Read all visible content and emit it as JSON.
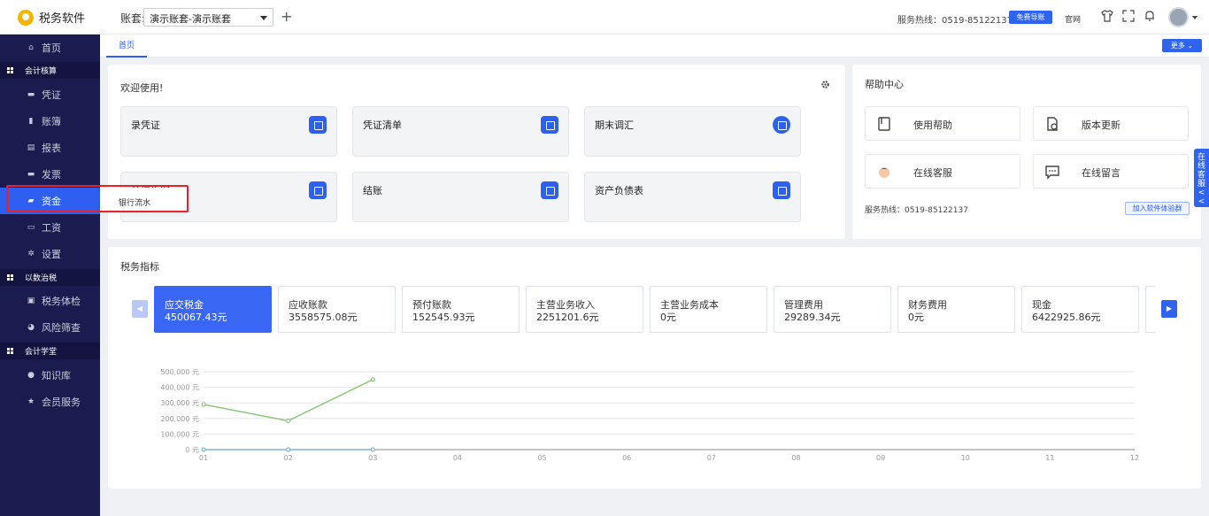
{
  "app": {
    "name": "税务软件"
  },
  "topbar": {
    "account_label": "账套:",
    "account_value": "演示账套-演示账套",
    "hotline": "服务热线：0519-85122137",
    "free_button": "免费导账",
    "official": "官网",
    "icons": [
      "shirt-icon",
      "fullscreen-icon",
      "bell-icon"
    ]
  },
  "sidebar": {
    "items": [
      {
        "label": "首页",
        "icon": "home-icon"
      },
      {
        "label": "会计核算",
        "group": true
      },
      {
        "label": "凭证",
        "icon": "voucher-icon"
      },
      {
        "label": "账簿",
        "icon": "ledger-icon"
      },
      {
        "label": "报表",
        "icon": "report-icon"
      },
      {
        "label": "发票",
        "icon": "invoice-icon"
      },
      {
        "label": "资金",
        "icon": "wallet-icon",
        "active": true
      },
      {
        "label": "工资",
        "icon": "salary-icon"
      },
      {
        "label": "设置",
        "icon": "gear-icon"
      },
      {
        "label": "以数治税",
        "group": true
      },
      {
        "label": "税务体检",
        "icon": "checkup-icon"
      },
      {
        "label": "风险筛查",
        "icon": "risk-icon"
      },
      {
        "label": "会计学堂",
        "group": true
      },
      {
        "label": "知识库",
        "icon": "knowledge-icon"
      },
      {
        "label": "会员服务",
        "icon": "star-icon"
      }
    ],
    "submenu": {
      "label": "银行流水"
    }
  },
  "tabs": {
    "home": "首页",
    "more": "更多 ⌄"
  },
  "welcome": {
    "title": "欢迎使用!",
    "tiles": [
      {
        "label": "录凭证"
      },
      {
        "label": "凭证清单"
      },
      {
        "label": "期末调汇"
      },
      {
        "label": "计提折旧"
      },
      {
        "label": "结账"
      },
      {
        "label": "资产负债表"
      }
    ]
  },
  "help": {
    "title": "帮助中心",
    "tiles": [
      {
        "label": "使用帮助",
        "icon": "book-icon"
      },
      {
        "label": "版本更新",
        "icon": "update-icon"
      },
      {
        "label": "在线客服",
        "icon": "customer-service-icon"
      },
      {
        "label": "在线留言",
        "icon": "message-icon"
      }
    ],
    "hotline": "服务热线：0519-85122137",
    "join_button": "加入软件体验群"
  },
  "side_float": "在线客服<<",
  "indicators": {
    "title": "税务指标",
    "items": [
      {
        "name": "应交税金",
        "value": "450067.43元"
      },
      {
        "name": "应收账款",
        "value": "3558575.08元"
      },
      {
        "name": "预付账款",
        "value": "152545.93元"
      },
      {
        "name": "主营业务收入",
        "value": "2251201.6元"
      },
      {
        "name": "主营业务成本",
        "value": "0元"
      },
      {
        "name": "管理费用",
        "value": "29289.34元"
      },
      {
        "name": "财务费用",
        "value": "0元"
      },
      {
        "name": "现金",
        "value": "6422925.86元"
      }
    ]
  },
  "chart_data": {
    "type": "line",
    "x": [
      "01",
      "02",
      "03",
      "04",
      "05",
      "06",
      "07",
      "08",
      "09",
      "10",
      "11",
      "12"
    ],
    "yticks": [
      "0 元",
      "100,000 元",
      "200,000 元",
      "300,000 元",
      "400,000 元",
      "500,000 元"
    ],
    "ylim": [
      0,
      500000
    ],
    "grid": true,
    "series": [
      {
        "color": "#8cc57e",
        "values": [
          290000,
          185000,
          450067.43
        ]
      },
      {
        "color": "#7fb3d5",
        "values": [
          0,
          0,
          0
        ]
      }
    ]
  }
}
